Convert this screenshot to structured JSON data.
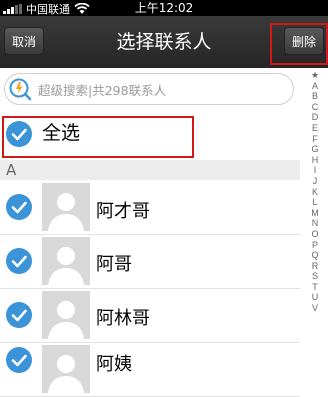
{
  "status_bar": {
    "carrier": "中国联通",
    "time": "上午12:02"
  },
  "nav": {
    "cancel_label": "取消",
    "title": "选择联系人",
    "delete_label": "删除"
  },
  "search": {
    "placeholder": "超级搜索|共298联系人"
  },
  "select_all_label": "全选",
  "section": "A",
  "contacts": [
    {
      "name": "阿才哥"
    },
    {
      "name": "阿哥"
    },
    {
      "name": "阿林哥"
    },
    {
      "name": "阿姨"
    }
  ],
  "index_letters": [
    "★",
    "A",
    "B",
    "C",
    "D",
    "E",
    "F",
    "G",
    "H",
    "I",
    "J",
    "K",
    "L",
    "M",
    "N",
    "O",
    "P",
    "Q",
    "R",
    "S",
    "T",
    "U",
    "V"
  ],
  "colors": {
    "accent": "#3b93d8",
    "highlight_red": "#d01818",
    "navbar": "#2c2c2c"
  }
}
